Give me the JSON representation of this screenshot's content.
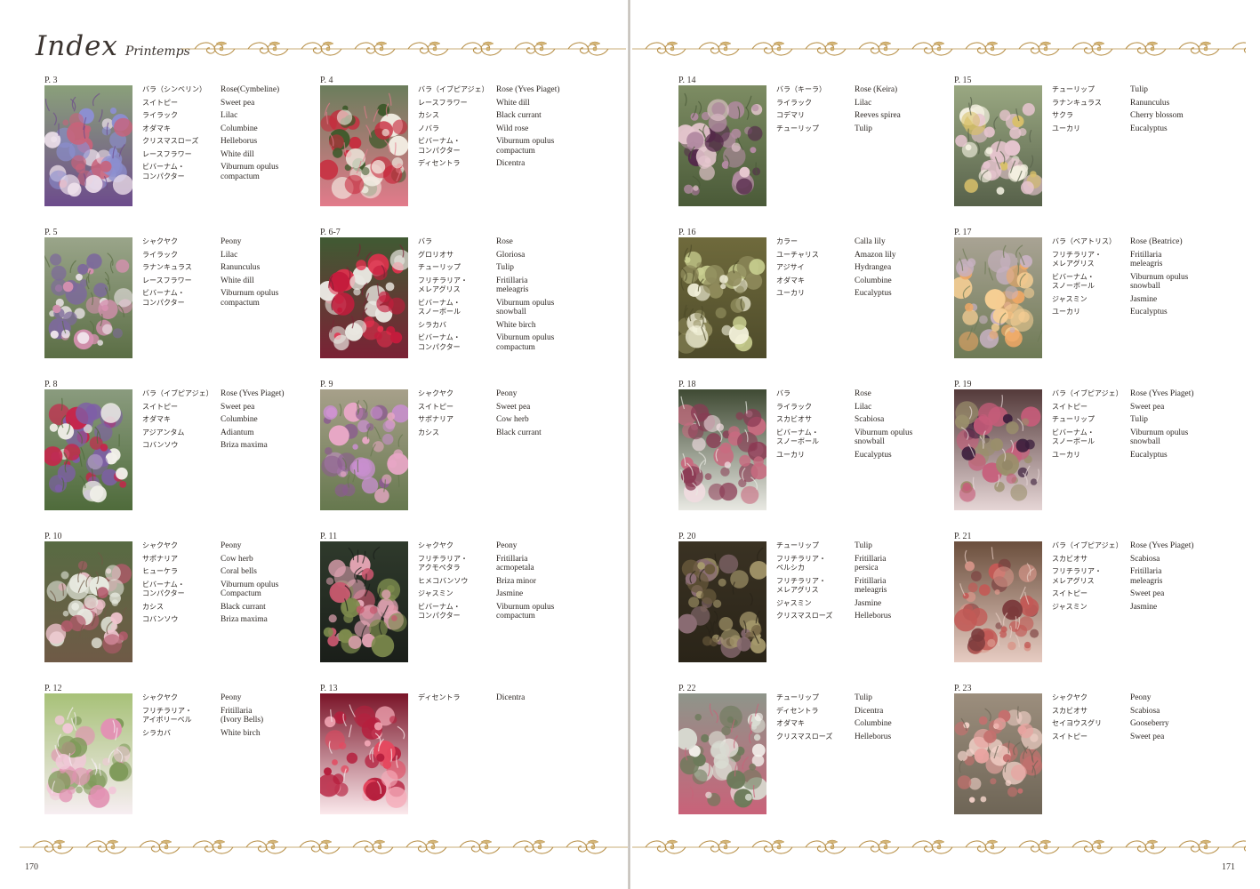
{
  "header": {
    "title": "Index",
    "subtitle": "Printemps"
  },
  "colors": {
    "gold": "#b8914a",
    "gold_light": "#d4b679",
    "text": "#2a2420"
  },
  "folios": {
    "left": "170",
    "right": "171"
  },
  "entries": [
    {
      "page": "P. 3",
      "photo": "pink-blue-bouquet",
      "flowers": [
        {
          "jp": "バラ（シンベリン）",
          "en": "Rose(Cymbeline)"
        },
        {
          "jp": "スイトピー",
          "en": "Sweet pea"
        },
        {
          "jp": "ライラック",
          "en": "Lilac"
        },
        {
          "jp": "オダマキ",
          "en": "Columbine"
        },
        {
          "jp": "クリスマスローズ",
          "en": "Helleborus"
        },
        {
          "jp": "レースフラワー",
          "en": "White dill"
        },
        {
          "jp": "ビバーナム・\nコンパクター",
          "en": "Viburnum opulus\ncompactum"
        }
      ]
    },
    {
      "page": "P. 4",
      "photo": "red-rose-bouquet-bridge",
      "flowers": [
        {
          "jp": "バラ（イブピアジェ）",
          "en": "Rose (Yves Piaget)"
        },
        {
          "jp": "レースフラワー",
          "en": "White dill"
        },
        {
          "jp": "カシス",
          "en": "Black currant"
        },
        {
          "jp": "ノバラ",
          "en": "Wild rose"
        },
        {
          "jp": "ビバーナム・\nコンパクター",
          "en": "Viburnum opulus\ncompactum"
        },
        {
          "jp": "ディセントラ",
          "en": "Dicentra"
        }
      ]
    },
    {
      "page": "P. 5",
      "photo": "peony-lilac-eiffel",
      "flowers": [
        {
          "jp": "シャクヤク",
          "en": "Peony"
        },
        {
          "jp": "ライラック",
          "en": "Lilac"
        },
        {
          "jp": "ラナンキュラス",
          "en": "Ranunculus"
        },
        {
          "jp": "レースフラワー",
          "en": "White dill"
        },
        {
          "jp": "ビバーナム・\nコンパクター",
          "en": "Viburnum opulus\ncompactum"
        }
      ]
    },
    {
      "page": "P. 6-7",
      "photo": "red-rose-gloriosa",
      "flowers": [
        {
          "jp": "バラ",
          "en": "Rose"
        },
        {
          "jp": "グロリオサ",
          "en": "Gloriosa"
        },
        {
          "jp": "チューリップ",
          "en": "Tulip"
        },
        {
          "jp": "フリチラリア・\nメレアグリス",
          "en": "Fritillaria\nmeleagris"
        },
        {
          "jp": "ビバーナム・\nスノーボール",
          "en": "Viburnum opulus\nsnowball"
        },
        {
          "jp": "シラカバ",
          "en": "White birch"
        },
        {
          "jp": "ビバーナム・\nコンパクター",
          "en": "Viburnum opulus\ncompactum"
        }
      ]
    },
    {
      "page": "P. 8",
      "photo": "red-rose-bouquet-river",
      "flowers": [
        {
          "jp": "バラ（イブピアジェ）",
          "en": "Rose (Yves Piaget)"
        },
        {
          "jp": "スイトピー",
          "en": "Sweet pea"
        },
        {
          "jp": "オダマキ",
          "en": "Columbine"
        },
        {
          "jp": "アジアンタム",
          "en": "Adiantum"
        },
        {
          "jp": "コバンソウ",
          "en": "Briza maxima"
        }
      ]
    },
    {
      "page": "P. 9",
      "photo": "peony-sweetpea-building",
      "flowers": [
        {
          "jp": "シャクヤク",
          "en": "Peony"
        },
        {
          "jp": "スイトピー",
          "en": "Sweet pea"
        },
        {
          "jp": "サポナリア",
          "en": "Cow herb"
        },
        {
          "jp": "カシス",
          "en": "Black currant"
        }
      ]
    },
    {
      "page": "P. 10",
      "photo": "peony-coralbells-cathedral",
      "flowers": [
        {
          "jp": "シャクヤク",
          "en": "Peony"
        },
        {
          "jp": "サポナリア",
          "en": "Cow herb"
        },
        {
          "jp": "ヒューケラ",
          "en": "Coral bells"
        },
        {
          "jp": "ビバーナム・\nコンパクター",
          "en": "Viburnum opulus\nCompactum"
        },
        {
          "jp": "カシス",
          "en": "Black currant"
        },
        {
          "jp": "コバンソウ",
          "en": "Briza maxima"
        }
      ]
    },
    {
      "page": "P. 11",
      "photo": "peony-fritillaria-railing",
      "flowers": [
        {
          "jp": "シャクヤク",
          "en": "Peony"
        },
        {
          "jp": "フリチラリア・\nアクモペタラ",
          "en": "Fritillaria\nacmopetala"
        },
        {
          "jp": "ヒメコバンソウ",
          "en": "Briza minor"
        },
        {
          "jp": "ジャスミン",
          "en": "Jasmine"
        },
        {
          "jp": "ビバーナム・\nコンパクター",
          "en": "Viburnum opulus\ncompactum"
        }
      ]
    },
    {
      "page": "P. 12",
      "photo": "peony-green-hydrangea",
      "flowers": [
        {
          "jp": "シャクヤク",
          "en": "Peony"
        },
        {
          "jp": "フリチラリア・\nアイボリーベル",
          "en": "Fritillaria\n(Ivory Bells)"
        },
        {
          "jp": "シラカバ",
          "en": "White birch"
        }
      ]
    },
    {
      "page": "P. 13",
      "photo": "bleeding-heart-closeup",
      "flowers": [
        {
          "jp": "ディセントラ",
          "en": "Dicentra"
        }
      ]
    },
    {
      "page": "P. 14",
      "photo": "purple-tulip-rose-park",
      "flowers": [
        {
          "jp": "バラ（キーラ）",
          "en": "Rose (Keira)"
        },
        {
          "jp": "ライラック",
          "en": "Lilac"
        },
        {
          "jp": "コデマリ",
          "en": "Reeves spirea"
        },
        {
          "jp": "チューリップ",
          "en": "Tulip"
        }
      ]
    },
    {
      "page": "P. 15",
      "photo": "tulip-cherry-urn",
      "flowers": [
        {
          "jp": "チューリップ",
          "en": "Tulip"
        },
        {
          "jp": "ラナンキュラス",
          "en": "Ranunculus"
        },
        {
          "jp": "サクラ",
          "en": "Cherry blossom"
        },
        {
          "jp": "ユーカリ",
          "en": "Eucalyptus"
        }
      ]
    },
    {
      "page": "P. 16",
      "photo": "white-calla-lily",
      "flowers": [
        {
          "jp": "カラー",
          "en": "Calla lily"
        },
        {
          "jp": "ユーチャリス",
          "en": "Amazon lily"
        },
        {
          "jp": "アジサイ",
          "en": "Hydrangea"
        },
        {
          "jp": "オダマキ",
          "en": "Columbine"
        },
        {
          "jp": "ユーカリ",
          "en": "Eucalyptus"
        }
      ]
    },
    {
      "page": "P. 17",
      "photo": "peach-rose-table",
      "flowers": [
        {
          "jp": "バラ（ベアトリス）",
          "en": "Rose (Beatrice)"
        },
        {
          "jp": "フリチラリア・\nメレアグリス",
          "en": "Fritillaria\nmeleagris"
        },
        {
          "jp": "ビバーナム・\nスノーボール",
          "en": "Viburnum opulus\nsnowball"
        },
        {
          "jp": "ジャスミン",
          "en": "Jasmine"
        },
        {
          "jp": "ユーカリ",
          "en": "Eucalyptus"
        }
      ]
    },
    {
      "page": "P. 18",
      "photo": "rose-scabiosa-vase",
      "flowers": [
        {
          "jp": "バラ",
          "en": "Rose"
        },
        {
          "jp": "ライラック",
          "en": "Lilac"
        },
        {
          "jp": "スカビオサ",
          "en": "Scabiosa"
        },
        {
          "jp": "ビバーナム・\nスノーボール",
          "en": "Viburnum opulus\nsnowball"
        },
        {
          "jp": "ユーカリ",
          "en": "Eucalyptus"
        }
      ]
    },
    {
      "page": "P. 19",
      "photo": "purple-tulip-cafe",
      "flowers": [
        {
          "jp": "バラ（イブピアジェ）",
          "en": "Rose (Yves Piaget)"
        },
        {
          "jp": "スイトピー",
          "en": "Sweet pea"
        },
        {
          "jp": "チューリップ",
          "en": "Tulip"
        },
        {
          "jp": "ビバーナム・\nスノーボール",
          "en": "Viburnum opulus\nsnowball"
        },
        {
          "jp": "ユーカリ",
          "en": "Eucalyptus"
        }
      ]
    },
    {
      "page": "P. 20",
      "photo": "dark-tulip-helleborus",
      "flowers": [
        {
          "jp": "チューリップ",
          "en": "Tulip"
        },
        {
          "jp": "フリチラリア・\nペルシカ",
          "en": "Fritillaria\npersica"
        },
        {
          "jp": "フリチラリア・\nメレアグリス",
          "en": "Fritillaria\nmeleagris"
        },
        {
          "jp": "ジャスミン",
          "en": "Jasmine"
        },
        {
          "jp": "クリスマスローズ",
          "en": "Helleborus"
        }
      ]
    },
    {
      "page": "P. 21",
      "photo": "rose-scabiosa-stone",
      "flowers": [
        {
          "jp": "バラ（イブピアジェ）",
          "en": "Rose (Yves Piaget)"
        },
        {
          "jp": "スカビオサ",
          "en": "Scabiosa"
        },
        {
          "jp": "フリチラリア・\nメレアグリス",
          "en": "Fritillaria\nmeleagris"
        },
        {
          "jp": "スイトピー",
          "en": "Sweet pea"
        },
        {
          "jp": "ジャスミン",
          "en": "Jasmine"
        }
      ]
    },
    {
      "page": "P. 22",
      "photo": "white-tulip-dicentra",
      "flowers": [
        {
          "jp": "チューリップ",
          "en": "Tulip"
        },
        {
          "jp": "ディセントラ",
          "en": "Dicentra"
        },
        {
          "jp": "オダマキ",
          "en": "Columbine"
        },
        {
          "jp": "クリスマスローズ",
          "en": "Helleborus"
        }
      ]
    },
    {
      "page": "P. 23",
      "photo": "peony-gooseberry-stone",
      "flowers": [
        {
          "jp": "シャクヤク",
          "en": "Peony"
        },
        {
          "jp": "スカビオサ",
          "en": "Scabiosa"
        },
        {
          "jp": "セイヨウスグリ",
          "en": "Gooseberry"
        },
        {
          "jp": "スイトピー",
          "en": "Sweet pea"
        }
      ]
    }
  ]
}
